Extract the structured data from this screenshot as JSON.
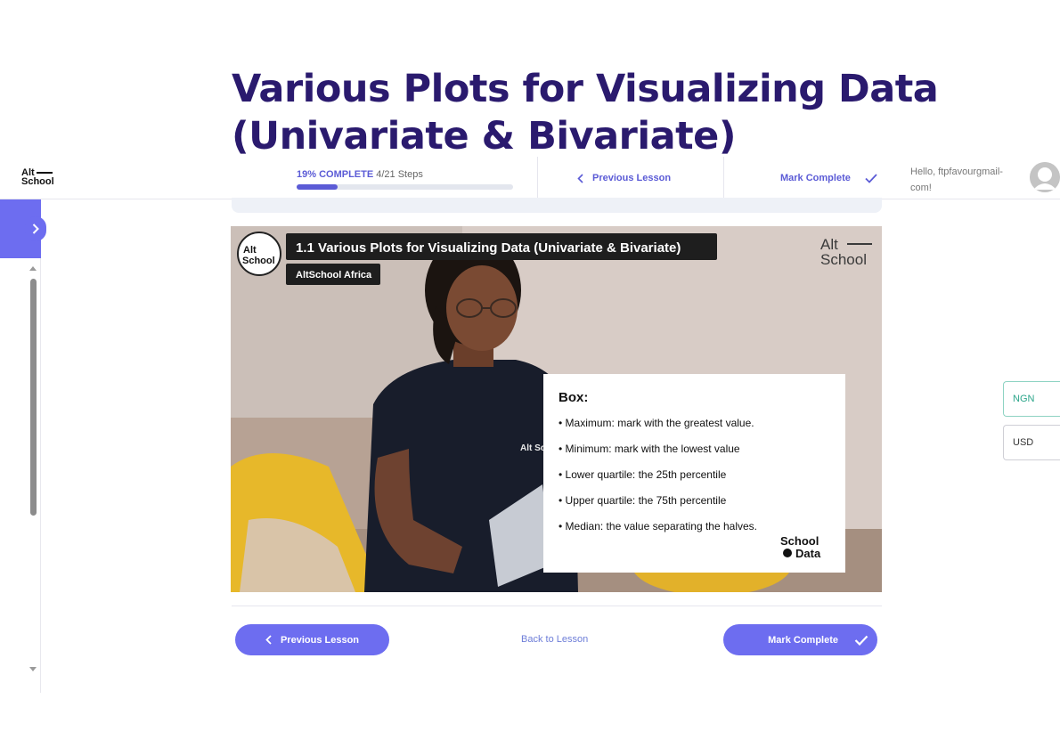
{
  "page": {
    "title": "Various Plots for Visualizing Data (Univariate & Bivariate)"
  },
  "header": {
    "logo_line1": "Alt",
    "logo_line2": "School",
    "progress_percent_label": "19% COMPLETE",
    "progress_steps_label": "4/21 Steps",
    "progress_fraction": 0.19,
    "previous_lesson_label": "Previous Lesson",
    "mark_complete_label": "Mark Complete",
    "greeting": "Hello, ftpfavourgmail-com!"
  },
  "video": {
    "title": "1.1 Various Plots for Visualizing Data (Univariate & Bivariate)",
    "channel": "AltSchool Africa",
    "logo_line1": "Alt",
    "logo_line2": "School",
    "card_heading": "Box:",
    "card_items": [
      "• Maximum: mark with the greatest value.",
      "• Minimum: mark with the lowest value",
      "• Lower quartile: the 25th percentile",
      "• Upper quartile: the 75th percentile",
      "• Median: the value separating the halves."
    ],
    "card_brand_line1": "School",
    "card_brand_line2": "Data",
    "shirt_text": "Alt School"
  },
  "footer": {
    "previous_lesson_label": "Previous Lesson",
    "back_to_lesson_label": "Back to Lesson",
    "mark_complete_label": "Mark Complete"
  },
  "currency": {
    "options": [
      "NGN",
      "USD"
    ]
  },
  "colors": {
    "accent": "#6d6df0",
    "title": "#2a1a6e",
    "ngn": "#2ba58a"
  }
}
